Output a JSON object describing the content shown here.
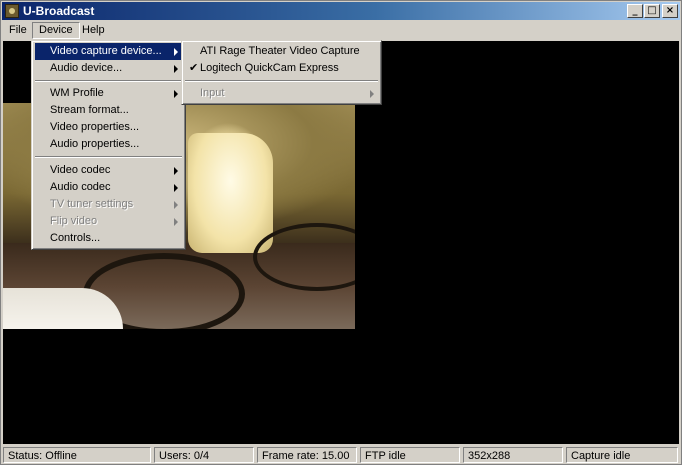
{
  "window": {
    "title": "U-Broadcast",
    "icon": "app-icon",
    "controls": {
      "minimize": "_",
      "maximize": "□",
      "close": "×"
    }
  },
  "menubar": {
    "items": [
      "File",
      "Device",
      "Help"
    ],
    "active": "Device"
  },
  "device_menu": {
    "items": [
      {
        "label": "Video capture device...",
        "submenu": true,
        "disabled": false,
        "highlighted": true
      },
      {
        "label": "Audio device...",
        "submenu": true,
        "disabled": false
      },
      {
        "label": "WM Profile",
        "submenu": true,
        "disabled": false
      },
      {
        "label": "Stream format...",
        "submenu": false,
        "disabled": false
      },
      {
        "label": "Video properties...",
        "submenu": false,
        "disabled": false
      },
      {
        "label": "Audio properties...",
        "submenu": false,
        "disabled": false
      },
      {
        "label": "Video codec",
        "submenu": true,
        "disabled": false
      },
      {
        "label": "Audio codec",
        "submenu": true,
        "disabled": false
      },
      {
        "label": "TV tuner settings",
        "submenu": true,
        "disabled": true
      },
      {
        "label": "Flip video",
        "submenu": true,
        "disabled": true
      },
      {
        "label": "Controls...",
        "submenu": false,
        "disabled": false
      }
    ]
  },
  "capture_submenu": {
    "items": [
      {
        "label": "ATI Rage Theater Video Capture",
        "checked": false,
        "disabled": false
      },
      {
        "label": "Logitech QuickCam Express",
        "checked": true,
        "disabled": false
      },
      {
        "label": "Input",
        "checked": false,
        "disabled": true,
        "submenu": true
      }
    ]
  },
  "statusbar": {
    "cells": [
      "Status: Offline",
      "Users: 0/4",
      "Frame rate: 15.00",
      "FTP idle",
      "352x288",
      "Capture idle"
    ]
  },
  "colors": {
    "titlebar_start": "#0a246a",
    "titlebar_end": "#a6caf0",
    "highlight": "#0a246a",
    "face": "#d4d0c8"
  }
}
